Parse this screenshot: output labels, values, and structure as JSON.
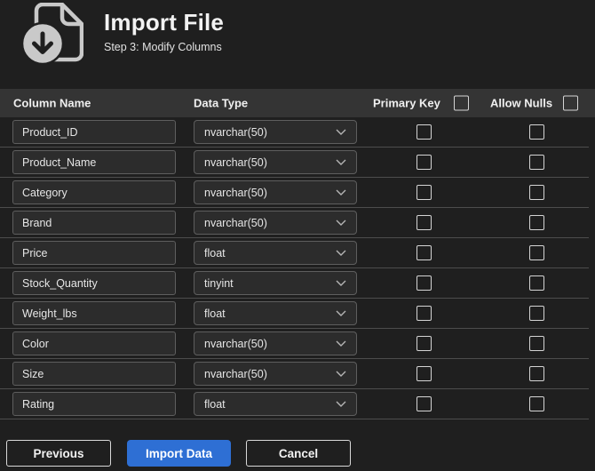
{
  "header": {
    "title": "Import File",
    "subtitle": "Step 3: Modify Columns",
    "icon": "file-import-icon"
  },
  "table": {
    "headers": {
      "column_name": "Column Name",
      "data_type": "Data Type",
      "primary_key": "Primary Key",
      "allow_nulls": "Allow Nulls"
    },
    "select_all": {
      "primary_key_checked": false,
      "allow_nulls_checked": false
    },
    "rows": [
      {
        "column_name": "Product_ID",
        "data_type": "nvarchar(50)",
        "primary_key": false,
        "allow_nulls": false
      },
      {
        "column_name": "Product_Name",
        "data_type": "nvarchar(50)",
        "primary_key": false,
        "allow_nulls": false
      },
      {
        "column_name": "Category",
        "data_type": "nvarchar(50)",
        "primary_key": false,
        "allow_nulls": false
      },
      {
        "column_name": "Brand",
        "data_type": "nvarchar(50)",
        "primary_key": false,
        "allow_nulls": false
      },
      {
        "column_name": "Price",
        "data_type": "float",
        "primary_key": false,
        "allow_nulls": false
      },
      {
        "column_name": "Stock_Quantity",
        "data_type": "tinyint",
        "primary_key": false,
        "allow_nulls": false
      },
      {
        "column_name": "Weight_lbs",
        "data_type": "float",
        "primary_key": false,
        "allow_nulls": false
      },
      {
        "column_name": "Color",
        "data_type": "nvarchar(50)",
        "primary_key": false,
        "allow_nulls": false
      },
      {
        "column_name": "Size",
        "data_type": "nvarchar(50)",
        "primary_key": false,
        "allow_nulls": false
      },
      {
        "column_name": "Rating",
        "data_type": "float",
        "primary_key": false,
        "allow_nulls": false
      }
    ]
  },
  "footer": {
    "previous_label": "Previous",
    "import_label": "Import Data",
    "cancel_label": "Cancel"
  },
  "colors": {
    "page_bg": "#1f1f1f",
    "table_header_bg": "#343434",
    "accent_blue": "#2e6fd4",
    "field_bg": "#2c2c2c",
    "field_border": "#5e5e5e",
    "separator": "#4d4d4d",
    "checkbox_border": "#d4d4d4",
    "text": "#f0f0f0"
  }
}
